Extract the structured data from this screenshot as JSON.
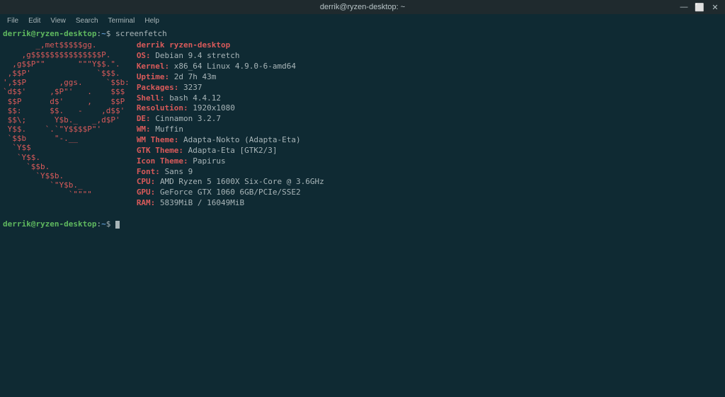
{
  "window": {
    "title": "derrik@ryzen-desktop: ~",
    "minimize": "—",
    "maximize": "⬜",
    "close": "✕"
  },
  "menu": {
    "file": "File",
    "edit": "Edit",
    "view": "View",
    "search": "Search",
    "terminal": "Terminal",
    "help": "Help"
  },
  "prompt": {
    "user": "derrik@ryzen-desktop",
    "colon": ":",
    "path": "~",
    "dollar": "$"
  },
  "command": "screenfetch",
  "ascii_art": "       _,met$$$$$gg.\n    ,g$$$$$$$$$$$$$$$P.\n  ,g$$P\"\"       \"\"\"Y$$.\".\n ,$$P'              `$$$.\n',$$P       ,ggs.     `$$b:\n`d$$'     ,$P\"'   .    $$$\n $$P      d$'     ,    $$P\n $$:      $$.   -    ,d$$'\n $$\\;      Y$b._   _,d$P'\n Y$$.    `.`\"Y$$$$P\"'\n `$$b      \"-.__\n  `Y$$\n   `Y$$.\n     `$$b.\n       `Y$$b.\n          `\"Y$b._\n              `\"\"\"\"",
  "sysinfo": {
    "header": "derrik ryzen-desktop",
    "os_key": "OS:",
    "os_val": "Debian 9.4 stretch",
    "kernel_key": "Kernel:",
    "kernel_val": "x86_64 Linux 4.9.0-6-amd64",
    "uptime_key": "Uptime:",
    "uptime_val": "2d 7h 43m",
    "packages_key": "Packages:",
    "packages_val": "3237",
    "shell_key": "Shell:",
    "shell_val": "bash 4.4.12",
    "resolution_key": "Resolution:",
    "resolution_val": "1920x1080",
    "de_key": "DE:",
    "de_val": "Cinnamon 3.2.7",
    "wm_key": "WM:",
    "wm_val": "Muffin",
    "wmtheme_key": "WM Theme:",
    "wmtheme_val": "Adapta-Nokto (Adapta-Eta)",
    "gtktheme_key": "GTK Theme:",
    "gtktheme_val": "Adapta-Eta [GTK2/3]",
    "icontheme_key": "Icon Theme:",
    "icontheme_val": "Papirus",
    "font_key": "Font:",
    "font_val": "Sans 9",
    "cpu_key": "CPU:",
    "cpu_val": "AMD Ryzen 5 1600X Six-Core @ 3.6GHz",
    "gpu_key": "GPU:",
    "gpu_val": "GeForce GTX 1060 6GB/PCIe/SSE2",
    "ram_key": "RAM:",
    "ram_val": "5839MiB / 16049MiB"
  }
}
